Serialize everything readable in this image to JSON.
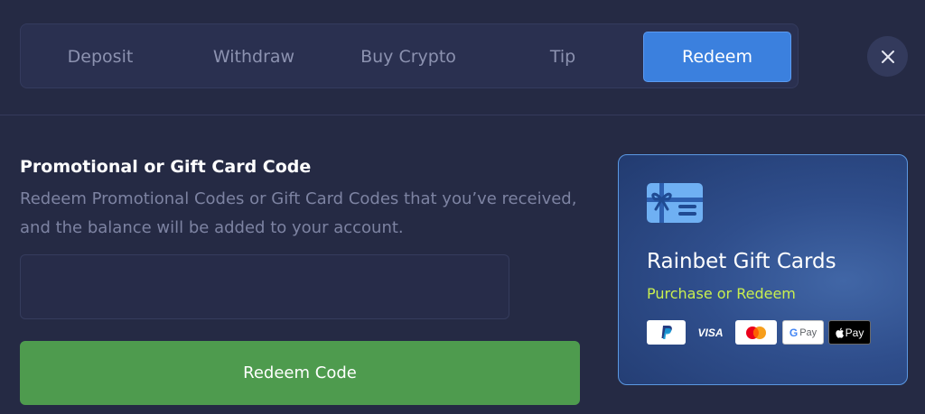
{
  "tabs": [
    {
      "label": "Deposit",
      "active": false
    },
    {
      "label": "Withdraw",
      "active": false
    },
    {
      "label": "Buy Crypto",
      "active": false
    },
    {
      "label": "Tip",
      "active": false
    },
    {
      "label": "Redeem",
      "active": true
    }
  ],
  "close": {
    "icon": "close-icon"
  },
  "redeem": {
    "heading": "Promotional or Gift Card Code",
    "description": "Redeem Promotional Codes or Gift Card Codes that you’ve received, and the balance will be added to your account.",
    "input_value": "",
    "input_placeholder": "",
    "button_label": "Redeem Code"
  },
  "gift_card": {
    "icon": "gift-card-icon",
    "title": "Rainbet Gift Cards",
    "subtitle": "Purchase or Redeem",
    "payment_methods": {
      "paypal": "paypal-icon",
      "visa": "VISA",
      "mastercard": "mastercard-icon",
      "google_pay_g": "G",
      "google_pay_text": "Pay",
      "apple_pay_text": "Pay"
    }
  },
  "colors": {
    "background": "#252a44",
    "accent_blue": "#3b80de",
    "action_green": "#4e9b4e",
    "highlight_lime": "#c9ef4f"
  }
}
